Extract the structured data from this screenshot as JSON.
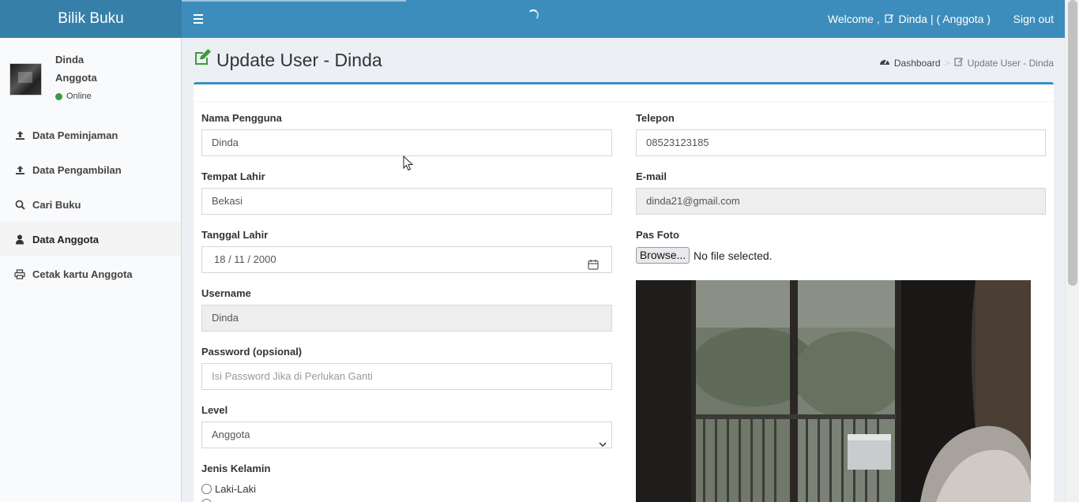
{
  "header": {
    "brand": "Bilik Buku",
    "welcome_prefix": "Welcome ,",
    "welcome_user": "Dinda | ( Anggota )",
    "signout_label": "Sign out"
  },
  "sidebar": {
    "user_name": "Dinda",
    "user_role": "Anggota",
    "status": "Online",
    "items": [
      {
        "label": "Data Peminjaman",
        "icon": "upload-icon"
      },
      {
        "label": "Data Pengambilan",
        "icon": "upload-icon"
      },
      {
        "label": "Cari Buku",
        "icon": "search-icon"
      },
      {
        "label": "Data Anggota",
        "icon": "user-icon",
        "active": true
      },
      {
        "label": "Cetak kartu Anggota",
        "icon": "print-icon"
      }
    ]
  },
  "page": {
    "title": "Update User - Dinda",
    "breadcrumb_home": "Dashboard",
    "breadcrumb_current": "Update User - Dinda"
  },
  "form": {
    "nama_label": "Nama Pengguna",
    "nama_value": "Dinda",
    "tempat_label": "Tempat Lahir",
    "tempat_value": "Bekasi",
    "tanggal_label": "Tanggal Lahir",
    "tanggal_value": "18 / 11 / 2000",
    "username_label": "Username",
    "username_value": "Dinda",
    "password_label": "Password (opsional)",
    "password_placeholder": "Isi Password Jika di Perlukan Ganti",
    "level_label": "Level",
    "level_value": "Anggota",
    "jk_label": "Jenis Kelamin",
    "jk_option1": "Laki-Laki",
    "telepon_label": "Telepon",
    "telepon_value": "08523123185",
    "email_label": "E-mail",
    "email_value": "dinda21@gmail.com",
    "foto_label": "Pas Foto",
    "browse_label": "Browse...",
    "nofile_text": "No file selected."
  },
  "colors": {
    "header": "#3c8dbc",
    "logo_bg": "#367fa9",
    "status_green": "#3d9a3d",
    "title_icon_green": "#3d9a3d"
  }
}
